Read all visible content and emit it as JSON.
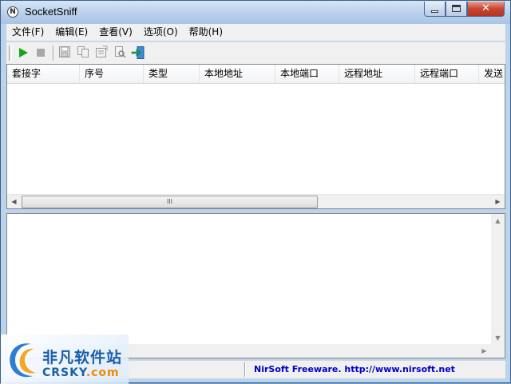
{
  "window": {
    "title": "SocketSniff",
    "icon": "socketsniff-app-icon",
    "controls": {
      "minimize": "minimize-icon",
      "maximize": "maximize-icon",
      "close": "✕"
    }
  },
  "menu": [
    {
      "label": "文件(F)"
    },
    {
      "label": "编辑(E)"
    },
    {
      "label": "查看(V)"
    },
    {
      "label": "选项(O)"
    },
    {
      "label": "帮助(H)"
    }
  ],
  "toolbar": {
    "buttons": [
      {
        "icon": "play-icon",
        "enabled": true
      },
      {
        "icon": "stop-icon",
        "enabled": false
      },
      {
        "icon": "save-icon",
        "enabled": false
      },
      {
        "icon": "copy-icon",
        "enabled": false
      },
      {
        "icon": "properties-icon",
        "enabled": false
      },
      {
        "icon": "find-icon",
        "enabled": false
      },
      {
        "icon": "exit-icon",
        "enabled": true
      }
    ]
  },
  "list": {
    "columns": [
      "套接字",
      "序号",
      "类型",
      "本地地址",
      "本地端口",
      "远程地址",
      "远程端口",
      "发送"
    ],
    "rows": [],
    "scroll_thumb_label": "III"
  },
  "status": {
    "left_text": "",
    "link_text": "NirSoft Freeware.  http://www.nirsoft.net"
  },
  "watermark": {
    "cn": "非凡软件站",
    "en_main": "CRSKY",
    "en_suffix": ".com"
  },
  "colors": {
    "play": "#1aa31a",
    "link": "#0000c8",
    "accent": "#1a5ea8",
    "close_button": "#c74532"
  }
}
